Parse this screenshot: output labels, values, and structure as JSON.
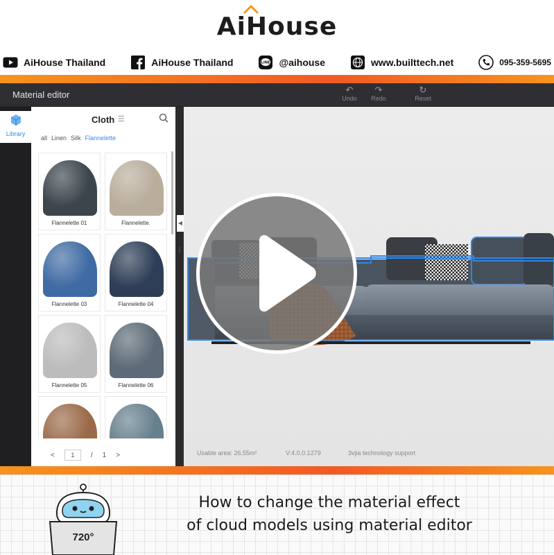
{
  "brand": {
    "name": "AiHouse",
    "accent": "#f7931e"
  },
  "social": [
    {
      "icon": "youtube-icon",
      "label": "AiHouse Thailand"
    },
    {
      "icon": "facebook-icon",
      "label": "AiHouse Thailand"
    },
    {
      "icon": "line-icon",
      "label": "@aihouse"
    },
    {
      "icon": "globe-icon",
      "label": "www.builttech.net"
    },
    {
      "icon": "phone-icon",
      "label": "095-359-5695"
    }
  ],
  "editor": {
    "title": "Material editor",
    "toolbar": {
      "undo": "Undo",
      "redo": "Redo",
      "reset": "Reset"
    },
    "rail": {
      "library": "Library"
    },
    "panel": {
      "title": "Cloth",
      "filters": [
        "all",
        "Linen",
        "Silk",
        "Flannelette"
      ],
      "active_filter": "Flannelette",
      "items": [
        {
          "name": "Flannelette 01",
          "color": "#3d454c"
        },
        {
          "name": "Flannelette.",
          "color": "#b9ad9c"
        },
        {
          "name": "Flannelette 03",
          "color": "#3f6aa3"
        },
        {
          "name": "Flannelette 04",
          "color": "#2e3e57"
        },
        {
          "name": "Flannelette 05",
          "color": "#bcbcbc"
        },
        {
          "name": "Flannelette 06",
          "color": "#5c6b77"
        },
        {
          "name": "",
          "color": "#9a6a48"
        },
        {
          "name": "",
          "color": "#66808d"
        }
      ],
      "pager": {
        "prev": "<",
        "page": "1",
        "sep": "/",
        "total": "1",
        "next": ">"
      }
    },
    "status": {
      "area": "Usable area: 26.55m²",
      "version": "V:4.0.0.1279",
      "support": "3vjia technology support"
    }
  },
  "footer": {
    "mascot_label": "720°",
    "headline_line1": "How to change the material effect",
    "headline_line2": "of cloud models using material editor"
  }
}
